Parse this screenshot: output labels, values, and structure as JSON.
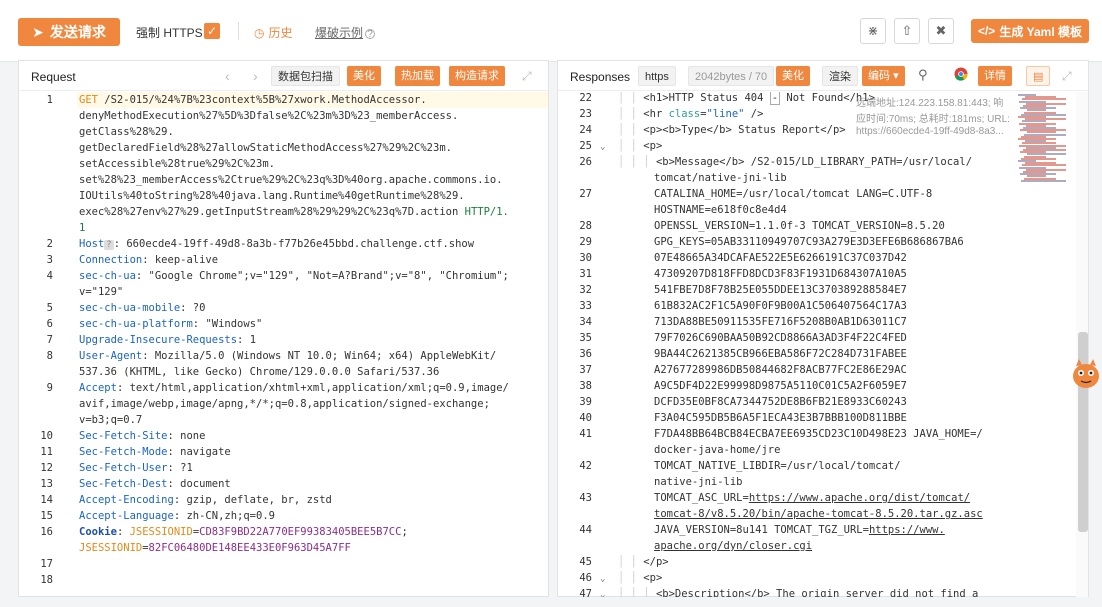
{
  "toolbar": {
    "send_label": "发送请求",
    "https_label": "强制 HTTPS",
    "https_checked": true,
    "history_label": "历史",
    "burst_label": "爆破示例",
    "yaml_label": "生成 Yaml 模板"
  },
  "request": {
    "title": "Request",
    "btn_scan": "数据包扫描",
    "btn_beautify": "美化",
    "btn_hotload": "热加载",
    "btn_build": "构造请求",
    "line_numbers": [
      "1",
      "2",
      "3",
      "4",
      "5",
      "6",
      "7",
      "8",
      "9",
      "10",
      "11",
      "12",
      "13",
      "14",
      "15",
      "16",
      "17",
      "18"
    ]
  },
  "response": {
    "title": "Responses",
    "scheme": "https",
    "size": "2042bytes / 70",
    "btn_beautify": "美化",
    "btn_render": "渲染",
    "btn_encode": "编码",
    "btn_detail": "详情",
    "meta_line1": "远端地址:124.223.158.81:443; 响",
    "meta_line2": "应时间:70ms; 总耗时:181ms; URL:",
    "meta_line3": "https://660ecde4-19ff-49d8-8a3...",
    "line_numbers": [
      "22",
      "23",
      "24",
      "25",
      "26",
      "27",
      "28",
      "29",
      "30",
      "31",
      "32",
      "33",
      "34",
      "35",
      "36",
      "37",
      "38",
      "39",
      "40",
      "41",
      "42",
      "43",
      "44",
      "45",
      "46",
      "47"
    ]
  },
  "colors": {
    "accent": "#f0873f",
    "key": "#1b64c2",
    "value": "#1a7f3c"
  }
}
